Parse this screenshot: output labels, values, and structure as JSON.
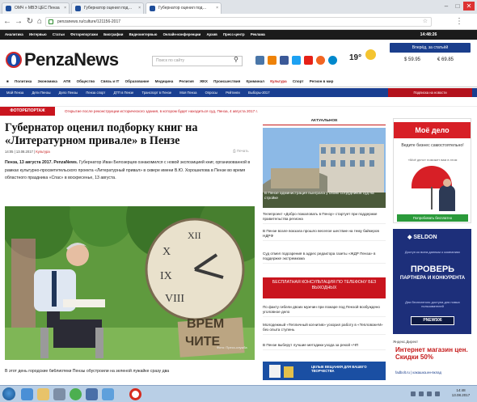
{
  "browser": {
    "tabs": [
      {
        "label": "ОМЧ » МВЭ ЦЕС Пенза"
      },
      {
        "label": "Губернатор оценил под…"
      },
      {
        "label": "Губернатор оценил под…"
      }
    ],
    "url": "penzanews.ru/culture/121156-2017",
    "window_buttons": [
      "–",
      "□",
      "✕"
    ]
  },
  "topnav": {
    "items": [
      "Аналитика",
      "Интервью",
      "Статьи",
      "Фоторепортажи",
      "Биографии",
      "Видеоинтервью",
      "Онлайн-конференции",
      "Архив",
      "Пресс-центр",
      "Реклама"
    ],
    "datetime": "14:48:26"
  },
  "header": {
    "logo": "PenzaNews",
    "search_placeholder": "Поиск по сайту",
    "weather": "19°",
    "subscribe": "Вперёд, за статьёй",
    "usd": "$ 59.95",
    "eur": "€ 69.85"
  },
  "category_nav": [
    "Политика",
    "Экономика",
    "АПК",
    "Общество",
    "Связь и IT",
    "Образование",
    "Медицина",
    "Религия",
    "ЖКХ",
    "Происшествия",
    "Криминал",
    "Культура",
    "Спорт",
    "Регион в мир"
  ],
  "blue_nav": {
    "items": [
      "Мой Пенза",
      "Дети Пензы",
      "Дело Пензы",
      "Пенза спорт",
      "ДТП в Пензе",
      "Транспорт в Пензе",
      "Моя Пенза",
      "Опросы",
      "Рейтинги",
      "Выборы-2017"
    ],
    "right": "Подписка на новости"
  },
  "ticker": {
    "label": "ФОТОРЕПОРТАЖ",
    "text": "Открытие после реконструкции исторического здания, в котором будет находиться суд, Пенза, 4 августа 2017 г."
  },
  "article": {
    "title": "Губернатор оценил подборку книг на «Литературном привале» в Пензе",
    "date": "14:05 | 13.08.2017",
    "category": "Культура",
    "print": "Печать",
    "lead_bold": "Пенза, 13 августа 2017. PenzaNews.",
    "lead": "Губернатор Иван Белозерцев ознакомился с новой экспозицией книг, организованной в рамках культурно-просветительского проекта «Литературный привал» в сквере имени В.Ю. Хорошилова в Пензе во время областного праздника «Спас» в воскресенье, 13 августа.",
    "photo_credit": "Фото: Пресс-служба",
    "sign_text_1": "ВРЕМ",
    "sign_text_2": "ЧИТЕ",
    "bottom_text": "В этот день городские библиотеки Пензы обустроили на зеленой лужайке сразу два"
  },
  "news": {
    "heading": "АКТУАЛЬНОЕ",
    "featured_caption": "В Пензе администрация выиграла у своих сотрудников суд на стройке",
    "items": [
      "Телепроект «Добро пожаловать в Пензу» стартует при поддержке правительства региона",
      "В Пензе возле вокзала прошло веселое шествие на тему байкеров НДРФ",
      "Суд отмел подозрения в адрес редактора газеты «ЖДР Пенза» в поддержке экстремизма",
      "По факту гибели двоих мужчин при пожаре под Пензой возбуждено уголовное дело",
      "Молодежный «Тепличный когнитив» ускорил работу в «Тепловом-М» без опыта ступень",
      "В Пензе выберут лучшие методики ухода за рекой «ЧП"
    ],
    "consult_banner": "БЕСПЛАТНАЯ КОНСУЛЬТАЦИЯ ПО ТЕЛЕФОНУ БЕЗ ВЫХОДНЫХ",
    "bottom_banner": "ЦЕЛЫЕ ВЕЩАНИЯ ДЛЯ ВАШЕГО ТВОРЧЕСТВА"
  },
  "ads": {
    "ad1_title": "Моё дело",
    "ad1_text": "Ведите бизнес самостоятельно!",
    "ad1_sub": "«Моё дело» поможет вам в этом",
    "ad1_button": "Попробовать бесплатно",
    "ad2_brand": "SELDON",
    "ad2_sub": "Доступ ко всем данным о компаниях",
    "ad2_big": "ПРОВЕРЬ",
    "ad2_small": "ПАРТНЕРА И КОНКУРЕНТА",
    "ad2_note": "Дни бесплатного доступа для новых пользователей",
    "ad2_promo": "PNEW506",
    "ad3_head": "Яндекс.Директ",
    "ad3_title": "Интернет магазин цен. Скидки 50%",
    "ad3_link": "fadbolt.ru | какашка.ин-вклад"
  },
  "taskbar": {
    "clock_time": "14:48",
    "clock_date": "13.08.2017"
  },
  "colors": {
    "brand_blue": "#1a3f91",
    "brand_red": "#c9151e"
  }
}
